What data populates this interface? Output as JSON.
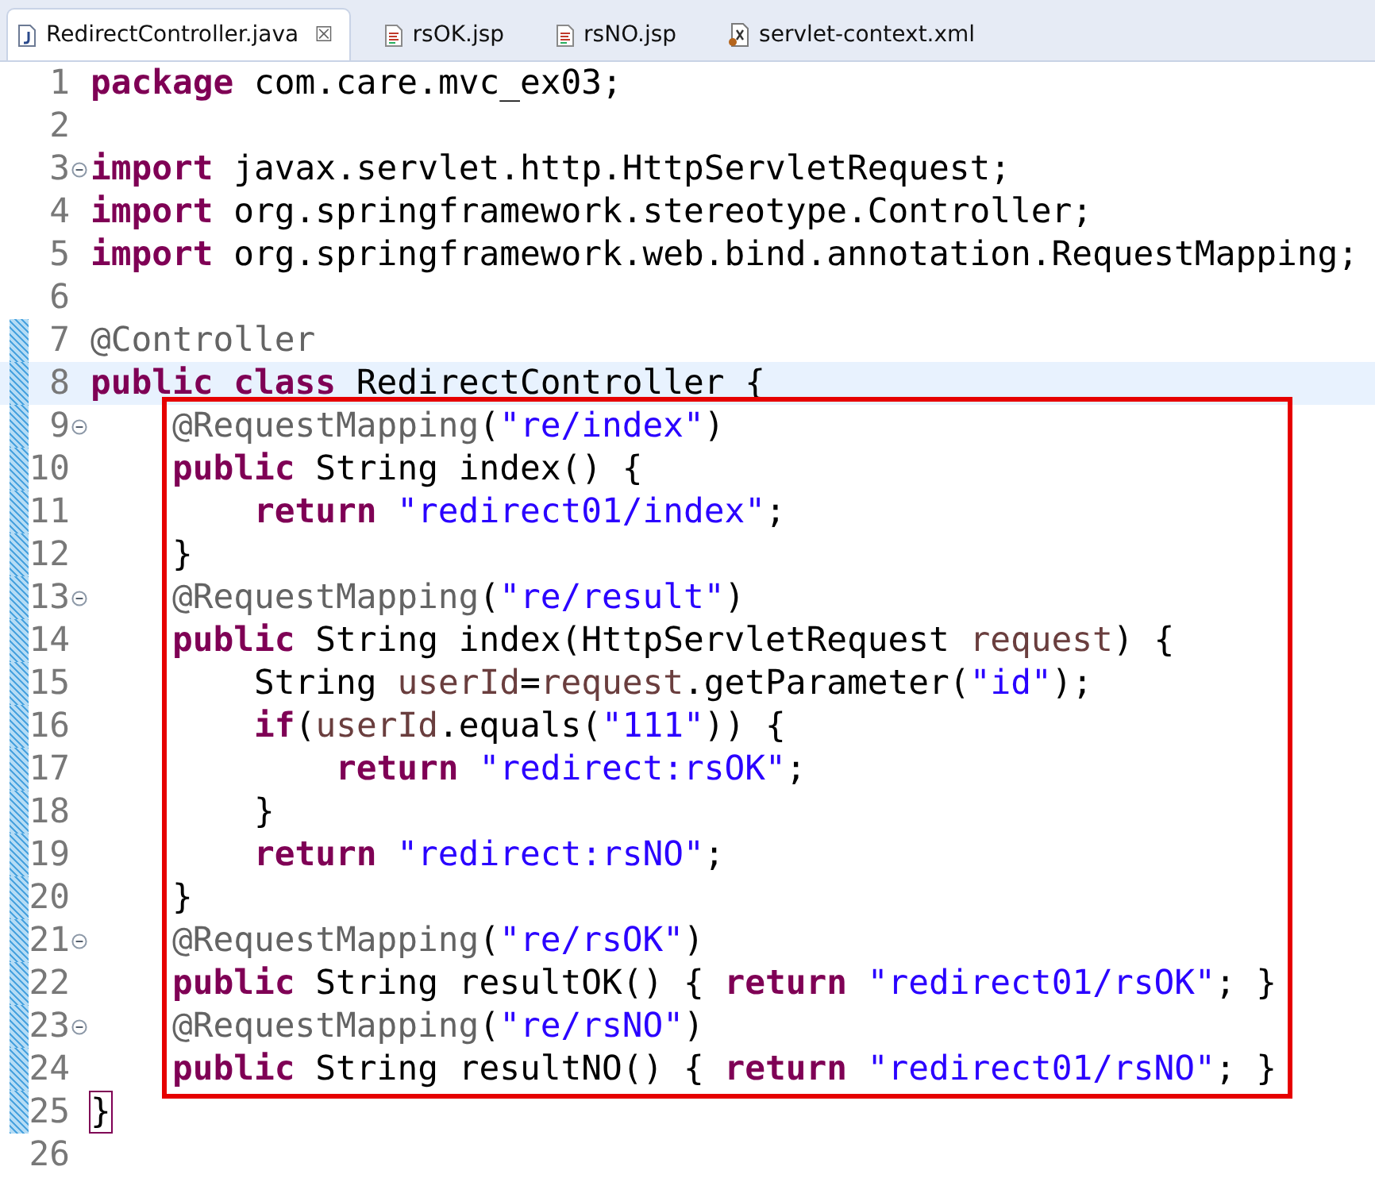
{
  "tabs": [
    {
      "label": "RedirectController.java",
      "kind": "java",
      "selected": true,
      "close": "☒"
    },
    {
      "label": "rsOK.jsp",
      "kind": "jsp",
      "selected": false
    },
    {
      "label": "rsNO.jsp",
      "kind": "jsp",
      "selected": false
    },
    {
      "label": "servlet-context.xml",
      "kind": "xml",
      "selected": false
    }
  ],
  "lines": [
    {
      "number": "1",
      "fold": false,
      "changed": false,
      "current": false,
      "boxed": false,
      "tokens": [
        {
          "kind": "keyword",
          "text": "package"
        },
        {
          "kind": "plain",
          "text": " com.care.mvc_ex03;"
        }
      ]
    },
    {
      "number": "2",
      "fold": false,
      "changed": false,
      "current": false,
      "boxed": false
    },
    {
      "number": "3",
      "fold": true,
      "changed": false,
      "current": false,
      "boxed": false,
      "tokens": [
        {
          "kind": "keyword",
          "text": "import"
        },
        {
          "kind": "plain",
          "text": " javax.servlet.http.HttpServletRequest;"
        }
      ]
    },
    {
      "number": "4",
      "fold": false,
      "changed": false,
      "current": false,
      "boxed": false,
      "tokens": [
        {
          "kind": "keyword",
          "text": "import"
        },
        {
          "kind": "plain",
          "text": " org.springframework.stereotype.Controller;"
        }
      ]
    },
    {
      "number": "5",
      "fold": false,
      "changed": false,
      "current": false,
      "boxed": false,
      "tokens": [
        {
          "kind": "keyword",
          "text": "import"
        },
        {
          "kind": "plain",
          "text": " org.springframework.web.bind.annotation.RequestMapping;"
        }
      ]
    },
    {
      "number": "6",
      "fold": false,
      "changed": false,
      "current": false,
      "boxed": false
    },
    {
      "number": "7",
      "fold": false,
      "changed": true,
      "current": false,
      "boxed": false,
      "tokens": [
        {
          "kind": "annotation",
          "text": "@Controller"
        }
      ]
    },
    {
      "number": "8",
      "fold": false,
      "changed": true,
      "current": true,
      "boxed": false,
      "tokens": [
        {
          "kind": "keyword",
          "text": "public class"
        },
        {
          "kind": "plain",
          "text": " RedirectController {"
        }
      ]
    },
    {
      "number": "9",
      "fold": true,
      "changed": true,
      "current": false,
      "boxed": true,
      "tokens": [
        {
          "kind": "annotation",
          "text": "    @RequestMapping"
        },
        {
          "kind": "plain",
          "text": "("
        },
        {
          "kind": "string",
          "text": "\"re/index\""
        },
        {
          "kind": "plain",
          "text": ")"
        }
      ]
    },
    {
      "number": "10",
      "fold": false,
      "changed": true,
      "current": false,
      "boxed": true,
      "tokens": [
        {
          "kind": "keyword",
          "text": "    public"
        },
        {
          "kind": "plain",
          "text": " String index() {"
        }
      ]
    },
    {
      "number": "11",
      "fold": false,
      "changed": true,
      "current": false,
      "boxed": true,
      "tokens": [
        {
          "kind": "keyword",
          "text": "        return"
        },
        {
          "kind": "string",
          "text": " \"redirect01/index\""
        },
        {
          "kind": "plain",
          "text": ";"
        }
      ]
    },
    {
      "number": "12",
      "fold": false,
      "changed": true,
      "current": false,
      "boxed": true,
      "tokens": [
        {
          "kind": "plain",
          "text": "    }"
        }
      ]
    },
    {
      "number": "13",
      "fold": true,
      "changed": true,
      "current": false,
      "boxed": true,
      "tokens": [
        {
          "kind": "annotation",
          "text": "    @RequestMapping"
        },
        {
          "kind": "plain",
          "text": "("
        },
        {
          "kind": "string",
          "text": "\"re/result\""
        },
        {
          "kind": "plain",
          "text": ")"
        }
      ]
    },
    {
      "number": "14",
      "fold": false,
      "changed": true,
      "current": false,
      "boxed": true,
      "tokens": [
        {
          "kind": "keyword",
          "text": "    public"
        },
        {
          "kind": "plain",
          "text": " String index(HttpServletRequest "
        },
        {
          "kind": "variable",
          "text": "request"
        },
        {
          "kind": "plain",
          "text": ") {"
        }
      ]
    },
    {
      "number": "15",
      "fold": false,
      "changed": true,
      "current": false,
      "boxed": true,
      "tokens": [
        {
          "kind": "plain",
          "text": "        String "
        },
        {
          "kind": "variable",
          "text": "userId"
        },
        {
          "kind": "plain",
          "text": "="
        },
        {
          "kind": "variable",
          "text": "request"
        },
        {
          "kind": "plain",
          "text": ".getParameter("
        },
        {
          "kind": "string",
          "text": "\"id\""
        },
        {
          "kind": "plain",
          "text": ");"
        }
      ]
    },
    {
      "number": "16",
      "fold": false,
      "changed": true,
      "current": false,
      "boxed": true,
      "tokens": [
        {
          "kind": "keyword",
          "text": "        if"
        },
        {
          "kind": "plain",
          "text": "("
        },
        {
          "kind": "variable",
          "text": "userId"
        },
        {
          "kind": "plain",
          "text": ".equals("
        },
        {
          "kind": "string",
          "text": "\"111\""
        },
        {
          "kind": "plain",
          "text": ")) {"
        }
      ]
    },
    {
      "number": "17",
      "fold": false,
      "changed": true,
      "current": false,
      "boxed": true,
      "tokens": [
        {
          "kind": "keyword",
          "text": "            return"
        },
        {
          "kind": "string",
          "text": " \"redirect:rsOK\""
        },
        {
          "kind": "plain",
          "text": ";"
        }
      ]
    },
    {
      "number": "18",
      "fold": false,
      "changed": true,
      "current": false,
      "boxed": true,
      "tokens": [
        {
          "kind": "plain",
          "text": "        }"
        }
      ]
    },
    {
      "number": "19",
      "fold": false,
      "changed": true,
      "current": false,
      "boxed": true,
      "tokens": [
        {
          "kind": "keyword",
          "text": "        return"
        },
        {
          "kind": "string",
          "text": " \"redirect:rsNO\""
        },
        {
          "kind": "plain",
          "text": ";"
        }
      ]
    },
    {
      "number": "20",
      "fold": false,
      "changed": true,
      "current": false,
      "boxed": true,
      "tokens": [
        {
          "kind": "plain",
          "text": "    }"
        }
      ]
    },
    {
      "number": "21",
      "fold": true,
      "changed": true,
      "current": false,
      "boxed": true,
      "tokens": [
        {
          "kind": "annotation",
          "text": "    @RequestMapping"
        },
        {
          "kind": "plain",
          "text": "("
        },
        {
          "kind": "string",
          "text": "\"re/rsOK\""
        },
        {
          "kind": "plain",
          "text": ")"
        }
      ]
    },
    {
      "number": "22",
      "fold": false,
      "changed": true,
      "current": false,
      "boxed": true,
      "tokens": [
        {
          "kind": "keyword",
          "text": "    public"
        },
        {
          "kind": "plain",
          "text": " String resultOK() { "
        },
        {
          "kind": "keyword",
          "text": "return"
        },
        {
          "kind": "string",
          "text": " \"redirect01/rsOK\""
        },
        {
          "kind": "plain",
          "text": "; }"
        }
      ]
    },
    {
      "number": "23",
      "fold": true,
      "changed": true,
      "current": false,
      "boxed": true,
      "tokens": [
        {
          "kind": "annotation",
          "text": "    @RequestMapping"
        },
        {
          "kind": "plain",
          "text": "("
        },
        {
          "kind": "string",
          "text": "\"re/rsNO\""
        },
        {
          "kind": "plain",
          "text": ")"
        }
      ]
    },
    {
      "number": "24",
      "fold": false,
      "changed": true,
      "current": false,
      "boxed": true,
      "tokens": [
        {
          "kind": "keyword",
          "text": "    public"
        },
        {
          "kind": "plain",
          "text": " String resultNO() { "
        },
        {
          "kind": "keyword",
          "text": "return"
        },
        {
          "kind": "string",
          "text": " \"redirect01/rsNO\""
        },
        {
          "kind": "plain",
          "text": "; }"
        }
      ]
    },
    {
      "number": "25",
      "fold": false,
      "changed": true,
      "current": false,
      "boxed": false,
      "tokens": [
        {
          "kind": "plain",
          "text": "}",
          "matched": true
        }
      ]
    },
    {
      "number": "26",
      "fold": false,
      "changed": false,
      "current": false,
      "boxed": false
    }
  ]
}
